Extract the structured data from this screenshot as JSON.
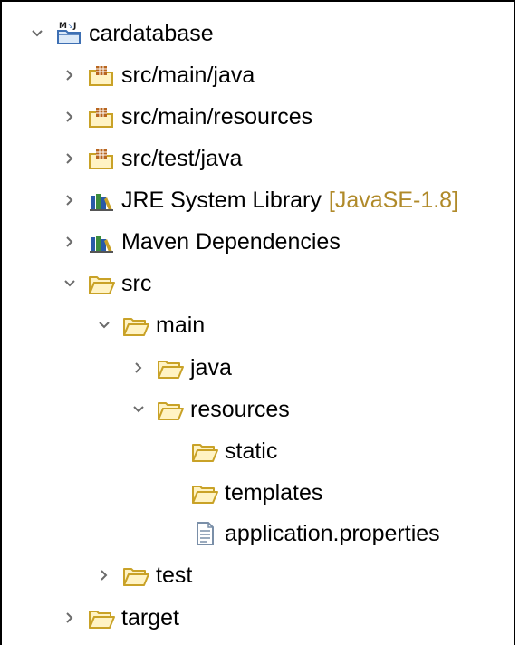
{
  "tree": {
    "project": {
      "label": "cardatabase",
      "expanded": true
    },
    "items": [
      {
        "label": "src/main/java",
        "expanded": false
      },
      {
        "label": "src/main/resources",
        "expanded": false
      },
      {
        "label": "src/test/java",
        "expanded": false
      },
      {
        "label": "JRE System Library",
        "decoration": "[JavaSE-1.8]",
        "expanded": false
      },
      {
        "label": "Maven Dependencies",
        "expanded": false
      },
      {
        "label": "src",
        "expanded": true
      },
      {
        "label": "main",
        "expanded": true
      },
      {
        "label": "java",
        "expanded": false
      },
      {
        "label": "resources",
        "expanded": true
      },
      {
        "label": "static"
      },
      {
        "label": "templates"
      },
      {
        "label": "application.properties"
      },
      {
        "label": "test",
        "expanded": false
      },
      {
        "label": "target",
        "expanded": false
      }
    ]
  },
  "colors": {
    "folder_stroke": "#c9a227",
    "folder_fill": "#fff3c4",
    "chevron": "#6b6b6b",
    "decoration": "#b08a2a"
  }
}
